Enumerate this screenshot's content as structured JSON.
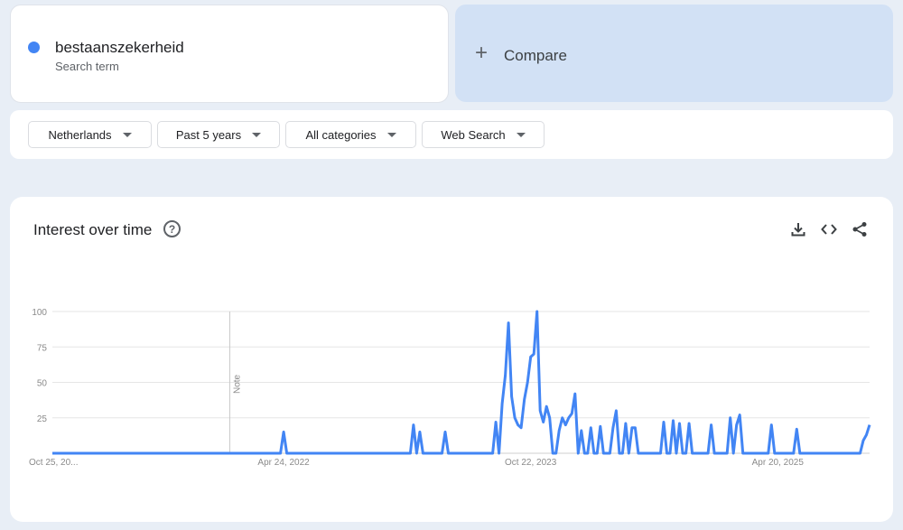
{
  "search_term": {
    "name": "bestaanszekerheid",
    "subtitle": "Search term",
    "color": "#4285f4"
  },
  "compare": {
    "label": "Compare"
  },
  "filters": {
    "region": "Netherlands",
    "period": "Past 5 years",
    "category": "All categories",
    "property": "Web Search"
  },
  "chart_card": {
    "title": "Interest over time",
    "help_icon": "help-circle-icon",
    "tools": [
      "download-icon",
      "embed-code-icon",
      "share-icon"
    ]
  },
  "chart_data": {
    "type": "line",
    "title": "Interest over time",
    "xlabel": "",
    "ylabel": "",
    "ylim": [
      0,
      100
    ],
    "yticks": [
      "100",
      "75",
      "50",
      "25"
    ],
    "xtick_labels": [
      "Oct 25, 20...",
      "Apr 24, 2022",
      "Oct 22, 2023",
      "Apr 20, 2025"
    ],
    "grid": true,
    "note": {
      "label": "Note",
      "week_index": 56
    },
    "series": [
      {
        "color": "#4285f4",
        "values": [
          0,
          0,
          0,
          0,
          0,
          0,
          0,
          0,
          0,
          0,
          0,
          0,
          0,
          0,
          0,
          0,
          0,
          0,
          0,
          0,
          0,
          0,
          0,
          0,
          0,
          0,
          0,
          0,
          0,
          0,
          0,
          0,
          0,
          0,
          0,
          0,
          0,
          0,
          0,
          0,
          0,
          0,
          0,
          0,
          0,
          0,
          0,
          0,
          0,
          0,
          0,
          0,
          0,
          0,
          0,
          0,
          0,
          0,
          0,
          0,
          0,
          0,
          0,
          0,
          0,
          0,
          0,
          0,
          0,
          0,
          0,
          0,
          0,
          15,
          0,
          0,
          0,
          0,
          0,
          0,
          0,
          0,
          0,
          0,
          0,
          0,
          0,
          0,
          0,
          0,
          0,
          0,
          0,
          0,
          0,
          0,
          0,
          0,
          0,
          0,
          0,
          0,
          0,
          0,
          0,
          0,
          0,
          0,
          0,
          0,
          0,
          0,
          0,
          0,
          20,
          0,
          15,
          0,
          0,
          0,
          0,
          0,
          0,
          0,
          15,
          0,
          0,
          0,
          0,
          0,
          0,
          0,
          0,
          0,
          0,
          0,
          0,
          0,
          0,
          0,
          22,
          0,
          35,
          55,
          92,
          40,
          25,
          20,
          18,
          38,
          50,
          68,
          70,
          100,
          30,
          22,
          33,
          25,
          0,
          0,
          16,
          25,
          20,
          25,
          28,
          42,
          0,
          16,
          0,
          0,
          18,
          0,
          0,
          19,
          0,
          0,
          0,
          18,
          30,
          0,
          0,
          21,
          0,
          18,
          18,
          0,
          0,
          0,
          0,
          0,
          0,
          0,
          0,
          22,
          0,
          0,
          23,
          0,
          21,
          0,
          0,
          21,
          0,
          0,
          0,
          0,
          0,
          0,
          20,
          0,
          0,
          0,
          0,
          0,
          25,
          0,
          20,
          27,
          0,
          0,
          0,
          0,
          0,
          0,
          0,
          0,
          0,
          20,
          0,
          0,
          0,
          0,
          0,
          0,
          0,
          17,
          0,
          0,
          0,
          0,
          0,
          0,
          0,
          0,
          0,
          0,
          0,
          0,
          0,
          0,
          0,
          0,
          0,
          0,
          0,
          0,
          9,
          13,
          20
        ]
      }
    ]
  }
}
